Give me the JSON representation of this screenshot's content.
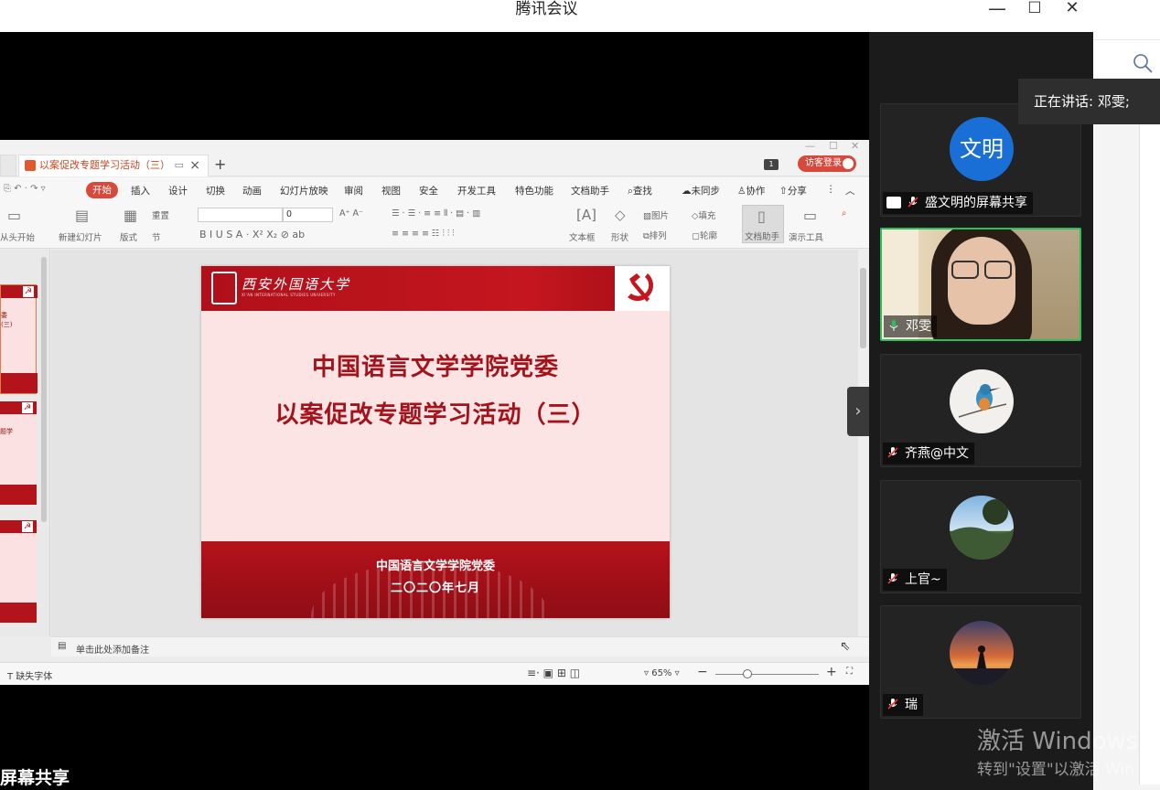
{
  "window": {
    "title": "腾讯会议",
    "minimize": "—",
    "maximize": "☐",
    "close": "✕"
  },
  "wps": {
    "tab_title": "以案促改专题学习活动（三）",
    "new_tab": "+",
    "visitor_login": "访客登录",
    "menu": [
      "开始",
      "插入",
      "设计",
      "切换",
      "动画",
      "幻灯片放映",
      "审阅",
      "视图",
      "安全",
      "开发工具",
      "特色功能",
      "文档助手",
      "查找",
      "未同步",
      "协作",
      "分享"
    ],
    "ribbon": {
      "from_start": "从头开始",
      "new_slide": "新建幻灯片",
      "layout": "版式",
      "section": "节",
      "reset": "重置",
      "font_size": "0",
      "textbox": "文本框",
      "shape": "形状",
      "picture": "图片",
      "arrange": "排列",
      "fill": "填充",
      "outline": "轮廓",
      "doc_assistant": "文档助手",
      "present_tools": "演示工具"
    },
    "notes_placeholder": "单击此处添加备注",
    "status_left": "缺失字体",
    "zoom": "65%"
  },
  "slide": {
    "univ_name": "西安外国语大学",
    "univ_en": "XI'AN INTERNATIONAL STUDIES UNIVERSITY",
    "title_line1": "中国语言文学学院党委",
    "title_line2": "以案促改专题学习活动（三）",
    "footer_org": "中国语言文学学院党委",
    "footer_date": "二〇二〇年七月"
  },
  "thumbnails": [
    {
      "text": "委\n(三)"
    },
    {
      "text": "题学"
    },
    {
      "text": ""
    }
  ],
  "participants": [
    {
      "name": "盛文明的屏幕共享",
      "avatar_text": "文明",
      "mic": "muted",
      "kind": "screen-share"
    },
    {
      "name": "邓雯",
      "mic": "on",
      "kind": "camera"
    },
    {
      "name": "齐燕@中文",
      "mic": "muted",
      "kind": "avatar-bird"
    },
    {
      "name": "上官~",
      "mic": "muted",
      "kind": "avatar-landscape"
    },
    {
      "name": "瑞",
      "mic": "muted",
      "kind": "avatar-sunset"
    }
  ],
  "speaking_tip": "正在讲话: 邓雯;",
  "watermark": {
    "line1": "激活 Windows",
    "line2": "转到\"设置\"以激活 Win"
  },
  "share_label": "屏幕共享",
  "colors": {
    "wps_accent": "#d8493c",
    "slide_red": "#b3131b",
    "slide_bg": "#fce4e4",
    "active_speaker": "#2fbf5a",
    "avatar_blue": "#1a6fd6"
  }
}
